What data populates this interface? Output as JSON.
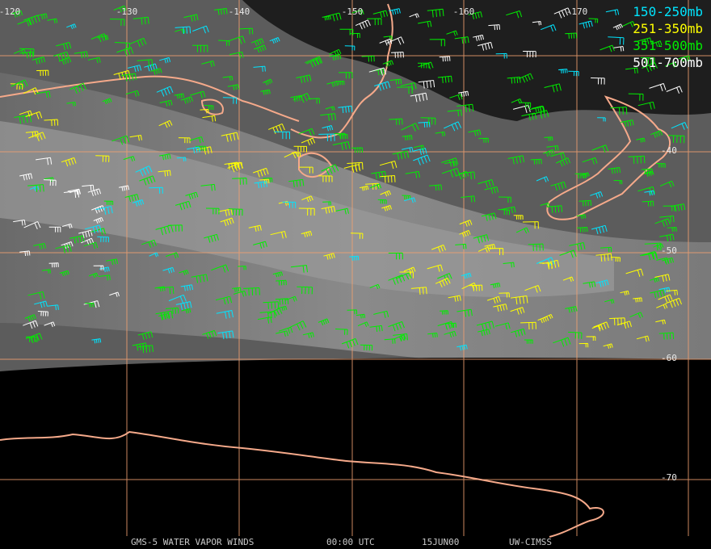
{
  "legend": [
    {
      "label": "150-250mb",
      "color": "#00e5ff"
    },
    {
      "label": "251-350mb",
      "color": "#ffff00"
    },
    {
      "label": "351-500mb",
      "color": "#00ee00"
    },
    {
      "label": "501-700mb",
      "color": "#ffffff"
    }
  ],
  "longitude_labels": [
    "-120",
    "-130",
    "-140",
    "-150",
    "-160",
    "-170"
  ],
  "latitude_labels": [
    "-40",
    "-50",
    "-60",
    "-70"
  ],
  "footer": {
    "product": "GMS-5 WATER VAPOR WINDS",
    "time": "00:00 UTC",
    "date": "15JUN00",
    "source": "UW-CIMSS"
  },
  "colors": {
    "grid_lines": "#f0a070",
    "coastline": "#f5a98a",
    "background_no_data": "#000000"
  }
}
